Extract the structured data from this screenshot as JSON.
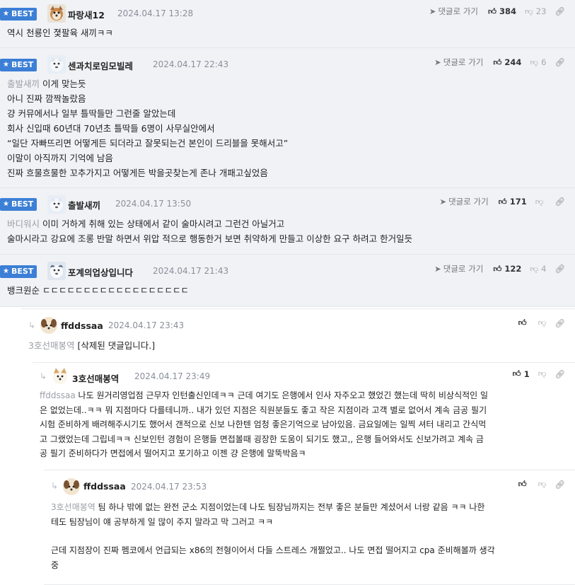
{
  "comments": [
    {
      "badge": "BEST",
      "nickname": "파랑새12",
      "date": "2024.04.17 13:28",
      "reply_label": "댓글로 가기",
      "up": "384",
      "down": "23",
      "lines": [
        "역시 천룡인 졏팔육 새끼ㅋㅋ"
      ]
    },
    {
      "badge": "BEST",
      "nickname": "센과치로임모빌레",
      "date": "2024.04.17 22:43",
      "reply_label": "댓글로 가기",
      "up": "244",
      "down": "6",
      "mention": "출발새끼",
      "lines": [
        "이게 맞는듯",
        "아니 진짜 깜짝놀랐음",
        "걍 커뮤에서나 일부 틀딱들만 그런줄 알았는데",
        "회사 신입때 60년대 70년초 틀딱들 6명이 사무실안에서",
        "“일단 자빠뜨리면 어떻게든 되더라고 잘못되는건 본인이 드리블을 못해서고”",
        "이말이 아직까지 기억에 남음",
        "진짜 흐물흐물한 꼬추가지고 어떻게든 박을곳찾는게 존나 개패고싶었음"
      ]
    },
    {
      "badge": "BEST",
      "nickname": "출발새끼",
      "date": "2024.04.17 13:50",
      "reply_label": "댓글로 가기",
      "up": "171",
      "down": "",
      "mention": "바디워시",
      "lines": [
        "이미 거하게 취해 있는 상태에서 같이 술마시려고 그런건 아닐거고",
        "술마시라고 강요에 조롱 반말 하면서 위압 적으로 행동한거 보면 취약하게 만들고 이상한 요구 하려고 한거일듯"
      ]
    },
    {
      "badge": "BEST",
      "nickname": "포계의업상입니다",
      "date": "2024.04.17 21:43",
      "reply_label": "댓글로 가기",
      "up": "122",
      "down": "4",
      "lines": [
        "뱅크원순 ㄷㄷㄷㄷㄷㄷㄷㄷㄷㄷㄷㄷㄷㄷㄷㄷㄷㄷ"
      ]
    }
  ],
  "replies": [
    {
      "nickname": "ffddssaa",
      "date": "2024.04.17 23:43",
      "up": "",
      "mention": "3호선매봉역",
      "lines": [
        "[삭제된 댓글입니다.]"
      ]
    },
    {
      "nickname": "3호선매봉역",
      "date": "2024.04.17 23:49",
      "up": "1",
      "mention": "ffddssaa",
      "lines": [
        "나도 원거리영업점 근무자 인턴출신인데ㅋㅋ 근데 여기도 은행에서 인사 자주오고 했었긴 했는데 딱히 비상식적인 일",
        "은 없었는데..ㅋㅋ 뭐 지점마다 다를테니까.. 내가 있던 지점은 직원분들도 좋고 작은 지점이라 고객 별로 없어서 계속 금공 필기",
        "시험 준비하게 배려해주시기도 했어서 갠적으로 신보 나한텐 엄청 좋은기억으로 남아있음. 금요일에는 일찍 셔터 내리고 간식먹",
        "고 그랬었는데 그립네ㅋㅋ 신보인턴 경험이 은행들 면접볼때 굉장한 도움이 되기도 했고,, 은행 들어와서도 신보가려고 계속 금",
        "공 필기 준비하다가 면접에서 떨어지고 포기하고 이젠 걍 은행에 말뚝박음ㅋ"
      ]
    },
    {
      "nickname": "ffddssaa",
      "date": "2024.04.17 23:53",
      "up": "",
      "mention": "3호선매봉역",
      "lines": [
        "팀 하나 밖에 없는 완전 군소 지점이었는데 나도 팀장님까지는 전부 좋은 분들만 계셨어서 너랑 같음 ㅋㅋ 나한",
        "테도 팀장님이 얘 공부하게 일 많이 주지 말라고 막 그러고 ㅋㅋ",
        "",
        "근데 지점장이 진짜 펨코에서 언급되는 x86의 전형이어서 다들 스트레스 개쩔었고.. 나도 면접 떨어지고 cpa 준비해볼까 생각",
        "중"
      ]
    }
  ]
}
